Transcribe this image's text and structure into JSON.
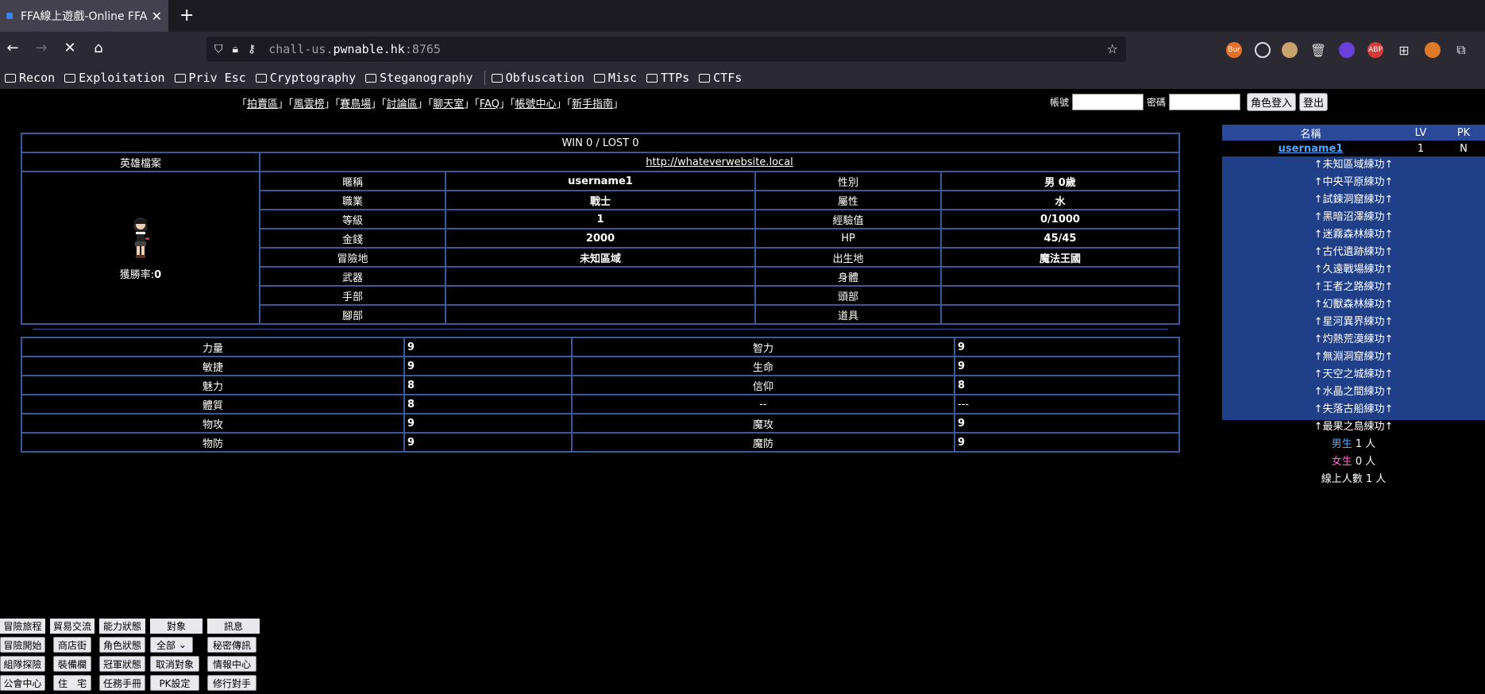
{
  "browser": {
    "tab_title": "FFA線上遊戲-Online FFA",
    "url_prefix": "chall-us.",
    "url_domain": "pwnable.hk",
    "url_port": ":8765",
    "bookmarks": [
      "Recon",
      "Exploitation",
      "Priv Esc",
      "Cryptography",
      "Steganography",
      "Obfuscation",
      "Misc",
      "TTPs",
      "CTFs"
    ],
    "ext_bur_label": "Bur",
    "ext_abp_label": "ABP"
  },
  "nav": {
    "prefix": "「",
    "suffix": "」",
    "links": [
      "拍賣區",
      "風雲榜",
      "賽鳥場",
      "討論區",
      "聊天室",
      "FAQ",
      "帳號中心",
      "新手指南"
    ]
  },
  "login": {
    "account_label": "帳號",
    "password_label": "密碼",
    "login_button": "角色登入",
    "logout_button": "登出"
  },
  "profile": {
    "record": "WIN 0 / LOST 0",
    "hero_file_label": "英雄檔案",
    "website": "http://whateverwebsite.local",
    "win_rate_label": "獲勝率:",
    "win_rate": "0",
    "rows": [
      {
        "k1": "暱稱",
        "v1": "username1",
        "k2": "性別",
        "v2": "男 0歲"
      },
      {
        "k1": "職業",
        "v1": "戰士",
        "k2": "屬性",
        "v2": "水"
      },
      {
        "k1": "等級",
        "v1": "1",
        "k2": "經驗值",
        "v2": "0/1000"
      },
      {
        "k1": "金錢",
        "v1": "2000",
        "k2": "HP",
        "v2": "45/45"
      },
      {
        "k1": "冒險地",
        "v1": "未知區域",
        "k2": "出生地",
        "v2": "魔法王國"
      },
      {
        "k1": "武器",
        "v1": "",
        "k2": "身體",
        "v2": ""
      },
      {
        "k1": "手部",
        "v1": "",
        "k2": "頭部",
        "v2": ""
      },
      {
        "k1": "腳部",
        "v1": "",
        "k2": "道具",
        "v2": ""
      }
    ]
  },
  "stats": [
    {
      "k1": "力量",
      "v1": "9",
      "k2": "智力",
      "v2": "9"
    },
    {
      "k1": "敏捷",
      "v1": "9",
      "k2": "生命",
      "v2": "9"
    },
    {
      "k1": "魅力",
      "v1": "8",
      "k2": "信仰",
      "v2": "8"
    },
    {
      "k1": "體質",
      "v1": "8",
      "k2": "--",
      "v2": "---"
    },
    {
      "k1": "物攻",
      "v1": "9",
      "k2": "魔攻",
      "v2": "9"
    },
    {
      "k1": "物防",
      "v1": "9",
      "k2": "魔防",
      "v2": "9"
    }
  ],
  "sidepanel": {
    "header": {
      "name": "名稱",
      "lv": "LV",
      "pk": "PK"
    },
    "player": {
      "name": "username1",
      "lv": "1",
      "pk": "N"
    },
    "areas": [
      "↑未知區域練功↑",
      "↑中央平原練功↑",
      "↑試鍊洞窟練功↑",
      "↑黑暗沼澤練功↑",
      "↑迷霧森林練功↑",
      "↑古代遺跡練功↑",
      "↑久遠戰場練功↑",
      "↑王者之路練功↑",
      "↑幻獸森林練功↑",
      "↑星河異界練功↑",
      "↑灼熱荒漠練功↑",
      "↑無淵洞窟練功↑",
      "↑天空之城練功↑",
      "↑水晶之間練功↑",
      "↑失落古船練功↑",
      "↑最果之島練功↑"
    ],
    "male_label": "男生",
    "male_count": "1 人",
    "female_label": "女生",
    "female_count": "0 人",
    "online_label": "線上人數 1 人"
  },
  "commands": {
    "headers": [
      "冒險旅程",
      "貿易交流",
      "能力狀態",
      "對象",
      "訊息"
    ],
    "row1": [
      "冒險開始",
      "商店街",
      "角色狀態",
      "全部",
      "秘密傳訊"
    ],
    "row2": [
      "組隊探險",
      "裝備欄",
      "冠軍狀態",
      "取消對象",
      "情報中心"
    ],
    "row3": [
      "公會中心",
      "住　宅",
      "任務手冊",
      "PK設定",
      "修行對手"
    ]
  }
}
